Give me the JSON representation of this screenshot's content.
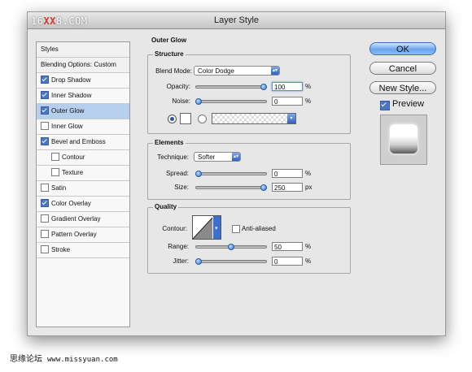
{
  "window": {
    "title": "Layer Style"
  },
  "watermark": {
    "prefix": "16",
    "highlight": "XX",
    "suffix": "8.COM"
  },
  "styles_list": {
    "header": "Styles",
    "blending": "Blending Options: Custom",
    "items": [
      {
        "label": "Drop Shadow",
        "checked": true,
        "selected": false,
        "sub": false
      },
      {
        "label": "Inner Shadow",
        "checked": true,
        "selected": false,
        "sub": false
      },
      {
        "label": "Outer Glow",
        "checked": true,
        "selected": true,
        "sub": false
      },
      {
        "label": "Inner Glow",
        "checked": false,
        "selected": false,
        "sub": false
      },
      {
        "label": "Bevel and Emboss",
        "checked": true,
        "selected": false,
        "sub": false
      },
      {
        "label": "Contour",
        "checked": false,
        "selected": false,
        "sub": true
      },
      {
        "label": "Texture",
        "checked": false,
        "selected": false,
        "sub": true
      },
      {
        "label": "Satin",
        "checked": false,
        "selected": false,
        "sub": false
      },
      {
        "label": "Color Overlay",
        "checked": true,
        "selected": false,
        "sub": false
      },
      {
        "label": "Gradient Overlay",
        "checked": false,
        "selected": false,
        "sub": false
      },
      {
        "label": "Pattern Overlay",
        "checked": false,
        "selected": false,
        "sub": false
      },
      {
        "label": "Stroke",
        "checked": false,
        "selected": false,
        "sub": false
      }
    ]
  },
  "outer_glow": {
    "section_title": "Outer Glow",
    "structure": {
      "title": "Structure",
      "blend_mode_label": "Blend Mode:",
      "blend_mode_value": "Color Dodge",
      "opacity_label": "Opacity:",
      "opacity_value": "100",
      "opacity_unit": "%",
      "opacity_fraction": 1.0,
      "noise_label": "Noise:",
      "noise_value": "0",
      "noise_unit": "%",
      "noise_fraction": 0.0
    },
    "elements": {
      "title": "Elements",
      "technique_label": "Technique:",
      "technique_value": "Softer",
      "spread_label": "Spread:",
      "spread_value": "0",
      "spread_unit": "%",
      "spread_fraction": 0.0,
      "size_label": "Size:",
      "size_value": "250",
      "size_unit": "px",
      "size_fraction": 1.0
    },
    "quality": {
      "title": "Quality",
      "contour_label": "Contour:",
      "anti_aliased_label": "Anti-aliased",
      "anti_aliased_checked": false,
      "range_label": "Range:",
      "range_value": "50",
      "range_unit": "%",
      "range_fraction": 0.5,
      "jitter_label": "Jitter:",
      "jitter_value": "0",
      "jitter_unit": "%",
      "jitter_fraction": 0.0
    }
  },
  "buttons": {
    "ok": "OK",
    "cancel": "Cancel",
    "new_style": "New Style..."
  },
  "preview": {
    "label": "Preview",
    "checked": true
  },
  "footer": {
    "forum": "思缘论坛",
    "url": "www.missyuan.com"
  },
  "colors": {
    "accent": "#4b76c5",
    "selected_row": "#b7cfee",
    "watermark_red": "#d23a2c"
  }
}
